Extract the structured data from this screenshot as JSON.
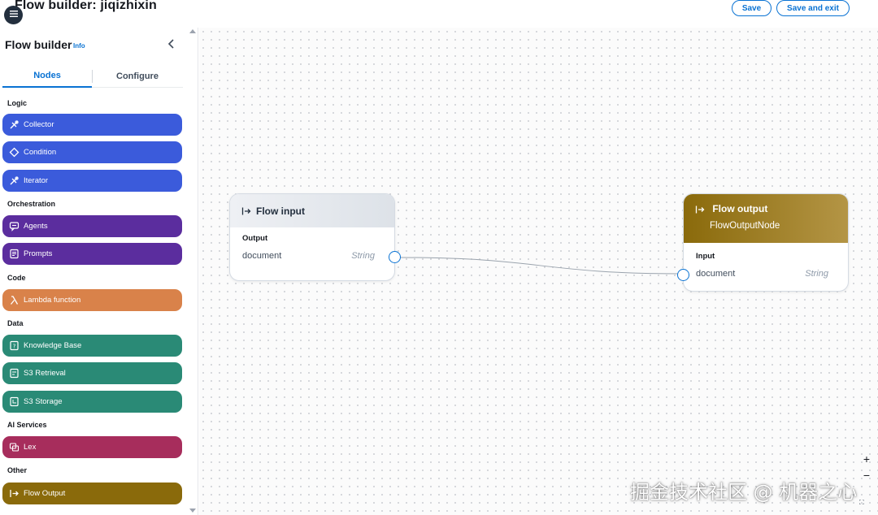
{
  "header": {
    "title": "Flow builder: jiqizhixin",
    "save_label": "Save",
    "save_exit_label": "Save and exit"
  },
  "sidebar": {
    "title": "Flow builder",
    "info_label": "Info",
    "tabs": [
      {
        "label": "Nodes",
        "active": true
      },
      {
        "label": "Configure",
        "active": false
      }
    ],
    "sections": [
      {
        "label": "Logic",
        "items": [
          {
            "label": "Collector",
            "icon": "collector-icon",
            "color": "#3b5bdb"
          },
          {
            "label": "Condition",
            "icon": "condition-icon",
            "color": "#3b5bdb"
          },
          {
            "label": "Iterator",
            "icon": "iterator-icon",
            "color": "#3b5bdb"
          }
        ]
      },
      {
        "label": "Orchestration",
        "items": [
          {
            "label": "Agents",
            "icon": "agent-icon",
            "color": "#5b2d9e"
          },
          {
            "label": "Prompts",
            "icon": "prompt-icon",
            "color": "#5b2d9e"
          }
        ]
      },
      {
        "label": "Code",
        "items": [
          {
            "label": "Lambda function",
            "icon": "lambda-icon",
            "color": "#d9824a"
          }
        ]
      },
      {
        "label": "Data",
        "items": [
          {
            "label": "Knowledge Base",
            "icon": "knowledge-base-icon",
            "color": "#2a8a76"
          },
          {
            "label": "S3 Retrieval",
            "icon": "s3-retrieval-icon",
            "color": "#2a8a76"
          },
          {
            "label": "S3 Storage",
            "icon": "s3-storage-icon",
            "color": "#2a8a76"
          }
        ]
      },
      {
        "label": "AI Services",
        "items": [
          {
            "label": "Lex",
            "icon": "lex-icon",
            "color": "#a72d5c"
          }
        ]
      },
      {
        "label": "Other",
        "items": [
          {
            "label": "Flow Output",
            "icon": "flow-output-icon",
            "color": "#8a6a0b"
          }
        ]
      }
    ]
  },
  "canvas": {
    "flow_input": {
      "title": "Flow input",
      "section": "Output",
      "field": "document",
      "type": "String"
    },
    "flow_output": {
      "title": "Flow output",
      "subtitle": "FlowOutputNode",
      "section": "Input",
      "field": "document",
      "type": "String"
    },
    "zoom_in": "+",
    "zoom_out": "−"
  },
  "watermark": "掘金技术社区 @ 机器之心"
}
